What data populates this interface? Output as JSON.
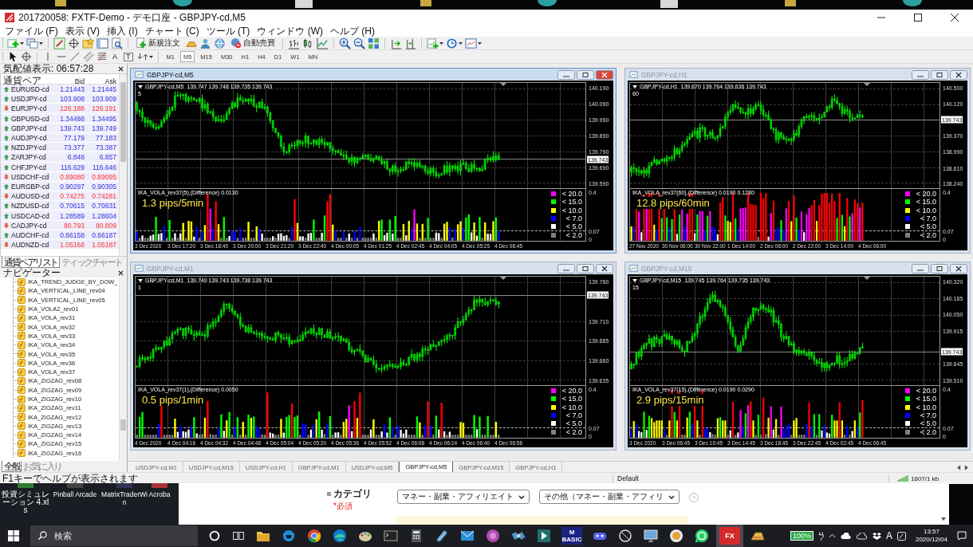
{
  "window": {
    "title": "201720058: FXTF-Demo - デモ口座 - GBPJPY-cd,M5"
  },
  "menu": [
    "ファイル (F)",
    "表示 (V)",
    "挿入 (I)",
    "チャート (C)",
    "ツール (T)",
    "ウィンドウ (W)",
    "ヘルプ (H)"
  ],
  "toolbar": {
    "order_button": "新規注文",
    "auto_trade_button": "自動売買",
    "text_tools": [
      "A",
      "T"
    ],
    "timeframes": [
      {
        "label": "M1",
        "selected": false
      },
      {
        "label": "M5",
        "selected": true
      },
      {
        "label": "M15",
        "selected": false
      },
      {
        "label": "M30",
        "selected": false
      },
      {
        "label": "H1",
        "selected": false
      },
      {
        "label": "H4",
        "selected": false
      },
      {
        "label": "D1",
        "selected": false
      },
      {
        "label": "W1",
        "selected": false
      },
      {
        "label": "MN",
        "selected": false
      }
    ]
  },
  "market_watch": {
    "title": "気配値表示: 06:57:28",
    "columns": [
      "通貨ペア",
      "Bid",
      "Ask"
    ],
    "rows": [
      {
        "symbol": "EURUSD-cd",
        "bid": "1.21443",
        "ask": "1.21445",
        "rising": true
      },
      {
        "symbol": "USDJPY-cd",
        "bid": "103.908",
        "ask": "103.909",
        "rising": true
      },
      {
        "symbol": "EURJPY-cd",
        "bid": "126.188",
        "ask": "126.191",
        "rising": false
      },
      {
        "symbol": "GBPUSD-cd",
        "bid": "1.34488",
        "ask": "1.34495",
        "rising": true
      },
      {
        "symbol": "GBPJPY-cd",
        "bid": "139.743",
        "ask": "139.749",
        "rising": true
      },
      {
        "symbol": "AUDJPY-cd",
        "bid": "77.179",
        "ask": "77.183",
        "rising": true
      },
      {
        "symbol": "NZDJPY-cd",
        "bid": "73.377",
        "ask": "73.387",
        "rising": true
      },
      {
        "symbol": "ZARJPY-cd",
        "bid": "6.848",
        "ask": "6.857",
        "rising": true
      },
      {
        "symbol": "CHFJPY-cd",
        "bid": "116.629",
        "ask": "116.646",
        "rising": true
      },
      {
        "symbol": "USDCHF-cd",
        "bid": "0.89080",
        "ask": "0.89095",
        "rising": false
      },
      {
        "symbol": "EURGBP-cd",
        "bid": "0.90297",
        "ask": "0.90305",
        "rising": true
      },
      {
        "symbol": "AUDUSD-cd",
        "bid": "0.74275",
        "ask": "0.74281",
        "rising": false
      },
      {
        "symbol": "NZDUSD-cd",
        "bid": "0.70615",
        "ask": "0.70631",
        "rising": true
      },
      {
        "symbol": "USDCAD-cd",
        "bid": "1.28589",
        "ask": "1.28604",
        "rising": true
      },
      {
        "symbol": "CADJPY-cd",
        "bid": "80.793",
        "ask": "80.809",
        "rising": false
      },
      {
        "symbol": "AUDCHF-cd",
        "bid": "0.66158",
        "ask": "0.66187",
        "rising": true
      },
      {
        "symbol": "AUDNZD-cd",
        "bid": "1.05168",
        "ask": "1.05187",
        "rising": false
      }
    ],
    "tabs": [
      {
        "label": "通貨ペアリスト",
        "selected": true
      },
      {
        "label": "ティックチャート",
        "selected": false
      }
    ]
  },
  "navigator": {
    "title": "ナビゲーター",
    "items": [
      "IKA_TREND_JUDGE_BY_DOW_",
      "IKA_VERTICAL_LINE_rev04",
      "IKA_VERTICAL_LINE_rev05",
      "IKA_VOLA2_rev01",
      "IKA_VOLA_rev31",
      "IKA_VOLA_rev32",
      "IKA_VOLA_rev33",
      "IKA_VOLA_rev34",
      "IKA_VOLA_rev35",
      "IKA_VOLA_rev36",
      "IKA_VOLA_rev37",
      "IKA_ZIGZAG_rev08",
      "IKA_ZIGZAG_rev09",
      "IKA_ZIGZAG_rev10",
      "IKA_ZIGZAG_rev11",
      "IKA_ZIGZAG_rev12",
      "IKA_ZIGZAG_rev13",
      "IKA_ZIGZAG_rev14",
      "IKA_ZIGZAG_rev15",
      "IKA_ZIGZAG_rev16"
    ],
    "tabs": [
      {
        "label": "全般",
        "selected": true
      },
      {
        "label": "お気に入り",
        "selected": false
      }
    ]
  },
  "charts": [
    {
      "title": "GBPJPY-cd,M5",
      "active": true,
      "header": "GBPJPY-cd,M5  139.747 139.748 139.735 139.743",
      "period": "5",
      "price_ticks": [
        "140.190",
        "140.090",
        "139.990",
        "139.890",
        "139.790",
        "139.690",
        "139.590"
      ],
      "current_price": "139.743",
      "indicator": "IKA_VOLA_rev37(5),(Difference) 0.0130",
      "pips": "1.3 pips/5min",
      "legend": [
        {
          "label": "< 20.0",
          "color": "#ff00ff"
        },
        {
          "label": "< 15.0",
          "color": "#00ff00"
        },
        {
          "label": "< 10.0",
          "color": "#ffff00"
        },
        {
          "label": "< 7.0",
          "color": "#0000ff"
        },
        {
          "label": "< 5.0",
          "color": "#ffffff"
        },
        {
          "label": "< 2.0",
          "color": "#808080"
        }
      ],
      "indicator_ticks": [
        "0.4",
        "0.07",
        "0"
      ],
      "times": [
        "3 Dec 2020",
        "3 Dec 17:20",
        "3 Dec 18:40",
        "3 Dec 20:00",
        "3 Dec 21:20",
        "3 Dec 22:40",
        "4 Dec 00:05",
        "4 Dec 01:25",
        "4 Dec 02:45",
        "4 Dec 04:05",
        "4 Dec 05:25",
        "4 Dec 06:45"
      ]
    },
    {
      "title": "GBPJPY-cd,H1",
      "active": false,
      "header": "GBPJPY-cd,H1  139.670 139.764 139.636 139.743",
      "period": "60",
      "price_ticks": [
        "140.500",
        "140.120",
        "139.370",
        "138.990",
        "138.610",
        "138.240"
      ],
      "current_price": "139.743",
      "indicator": "IKA_VOLA_rev37(60),(Difference) 0.0190 0.1280",
      "pips": "12.8 pips/60min",
      "legend": [
        {
          "label": "< 20.0",
          "color": "#ff00ff"
        },
        {
          "label": "< 15.0",
          "color": "#00ff00"
        },
        {
          "label": "< 10.0",
          "color": "#ffff00"
        },
        {
          "label": "< 7.0",
          "color": "#0000ff"
        },
        {
          "label": "< 5.0",
          "color": "#ffffff"
        },
        {
          "label": "< 2.0",
          "color": "#808080"
        }
      ],
      "indicator_ticks": [
        "0.4",
        "0.07",
        "0"
      ],
      "times": [
        "27 Nov 2020",
        "30 Nov 06:00",
        "30 Nov 22:00",
        "1 Dec 14:00",
        "2 Dec 06:00",
        "2 Dec 22:00",
        "3 Dec 14:00",
        "4 Dec 06:00"
      ]
    },
    {
      "title": "GBPJPY-cd,M1",
      "active": false,
      "header": "GBPJPY-cd,M1  139.740 139.743 139.738 139.743",
      "period": "1",
      "price_ticks": [
        "139.760",
        "139.710",
        "139.685",
        "139.660",
        "139.635"
      ],
      "current_price": "139.743",
      "indicator": "IKA_VOLA_rev37(1),(Difference) 0.0050",
      "pips": "0.5 pips/1min",
      "legend": [
        {
          "label": "< 20.0",
          "color": "#ff00ff"
        },
        {
          "label": "< 15.0",
          "color": "#00ff00"
        },
        {
          "label": "< 10.0",
          "color": "#ffff00"
        },
        {
          "label": "< 7.0",
          "color": "#0000ff"
        },
        {
          "label": "< 5.0",
          "color": "#ffffff"
        },
        {
          "label": "< 2.0",
          "color": "#808080"
        }
      ],
      "indicator_ticks": [
        "0.4",
        "0.07",
        "0"
      ],
      "times": [
        "4 Dec 2020",
        "4 Dec 04:16",
        "4 Dec 04:32",
        "4 Dec 04:48",
        "4 Dec 05:04",
        "4 Dec 05:20",
        "4 Dec 05:36",
        "4 Dec 05:52",
        "4 Dec 06:08",
        "4 Dec 06:24",
        "4 Dec 06:40",
        "4 Dec 06:56"
      ]
    },
    {
      "title": "GBPJPY-cd,M15",
      "active": false,
      "header": "GBPJPY-cd,M15  139.745 139.764 139.735 139.743",
      "period": "15",
      "price_ticks": [
        "140.320",
        "140.185",
        "140.050",
        "139.915",
        "139.645",
        "139.510"
      ],
      "current_price": "139.743",
      "indicator": "IKA_VOLA_rev37(15),(Difference) 0.0190 0.0290",
      "pips": "2.9 pips/15min",
      "legend": [
        {
          "label": "< 20.0",
          "color": "#ff00ff"
        },
        {
          "label": "< 15.0",
          "color": "#00ff00"
        },
        {
          "label": "< 10.0",
          "color": "#ffff00"
        },
        {
          "label": "< 7.0",
          "color": "#0000ff"
        },
        {
          "label": "< 5.0",
          "color": "#ffffff"
        },
        {
          "label": "< 2.0",
          "color": "#808080"
        }
      ],
      "indicator_ticks": [
        "0.4",
        "0.07",
        "0"
      ],
      "times": [
        "3 Dec 2020",
        "3 Dec 06:45",
        "3 Dec 10:45",
        "3 Dec 14:45",
        "3 Dec 18:45",
        "3 Dec 22:45",
        "4 Dec 02:45",
        "4 Dec 06:45"
      ]
    }
  ],
  "chart_tabs": [
    {
      "label": "USDJPY-cd,M1",
      "selected": false
    },
    {
      "label": "USDJPY-cd,M15",
      "selected": false
    },
    {
      "label": "USDJPY-cd,H1",
      "selected": false
    },
    {
      "label": "GBPJPY-cd,M1",
      "selected": false
    },
    {
      "label": "USDJPY-cd,M5",
      "selected": false
    },
    {
      "label": "GBPJPY-cd,M5",
      "selected": true
    },
    {
      "label": "GBPJPY-cd,M15",
      "selected": false
    },
    {
      "label": "GBPJPY-cd,H1",
      "selected": false
    }
  ],
  "status_bar": {
    "hint": "F1キーでヘルプが表示されます",
    "profile": "Default",
    "traffic": "1607/1 kb"
  },
  "desktop_icons": [
    {
      "label": "投資シミュレーション 4.xls"
    },
    {
      "label": "Pinball Arcade"
    },
    {
      "label": "MatrixTraderWin"
    },
    {
      "label": "Acroba"
    }
  ],
  "web_form": {
    "label": "カテゴリ",
    "required": "*必須",
    "selects": [
      "マネー・副業・アフィリエイト",
      "その他（マネー・副業・アフィリ"
    ],
    "help": "?"
  },
  "taskbar": {
    "search_placeholder": "検索",
    "apps": [
      {
        "kind": "icon",
        "selected": false
      },
      {
        "kind": "icon",
        "selected": false
      },
      {
        "kind": "icon",
        "selected": false
      },
      {
        "kind": "icon",
        "selected": false
      },
      {
        "kind": "icon",
        "selected": false
      },
      {
        "kind": "icon",
        "selected": false
      },
      {
        "kind": "icon",
        "selected": false
      },
      {
        "kind": "icon",
        "selected": false
      },
      {
        "kind": "icon",
        "selected": false
      },
      {
        "kind": "icon",
        "selected": false
      },
      {
        "kind": "icon",
        "selected": false
      },
      {
        "kind": "icon",
        "selected": false
      },
      {
        "kind": "text",
        "text": "M BASIC",
        "selected": false
      },
      {
        "kind": "icon",
        "selected": false
      },
      {
        "kind": "icon",
        "selected": false
      },
      {
        "kind": "icon",
        "selected": false
      },
      {
        "kind": "icon",
        "selected": false
      },
      {
        "kind": "icon",
        "selected": false
      },
      {
        "kind": "text",
        "text": "FX",
        "selected": true
      },
      {
        "kind": "icon",
        "selected": false
      }
    ],
    "battery": "100%",
    "ime": "A",
    "time": "13:57",
    "date": "2020/12/04"
  }
}
